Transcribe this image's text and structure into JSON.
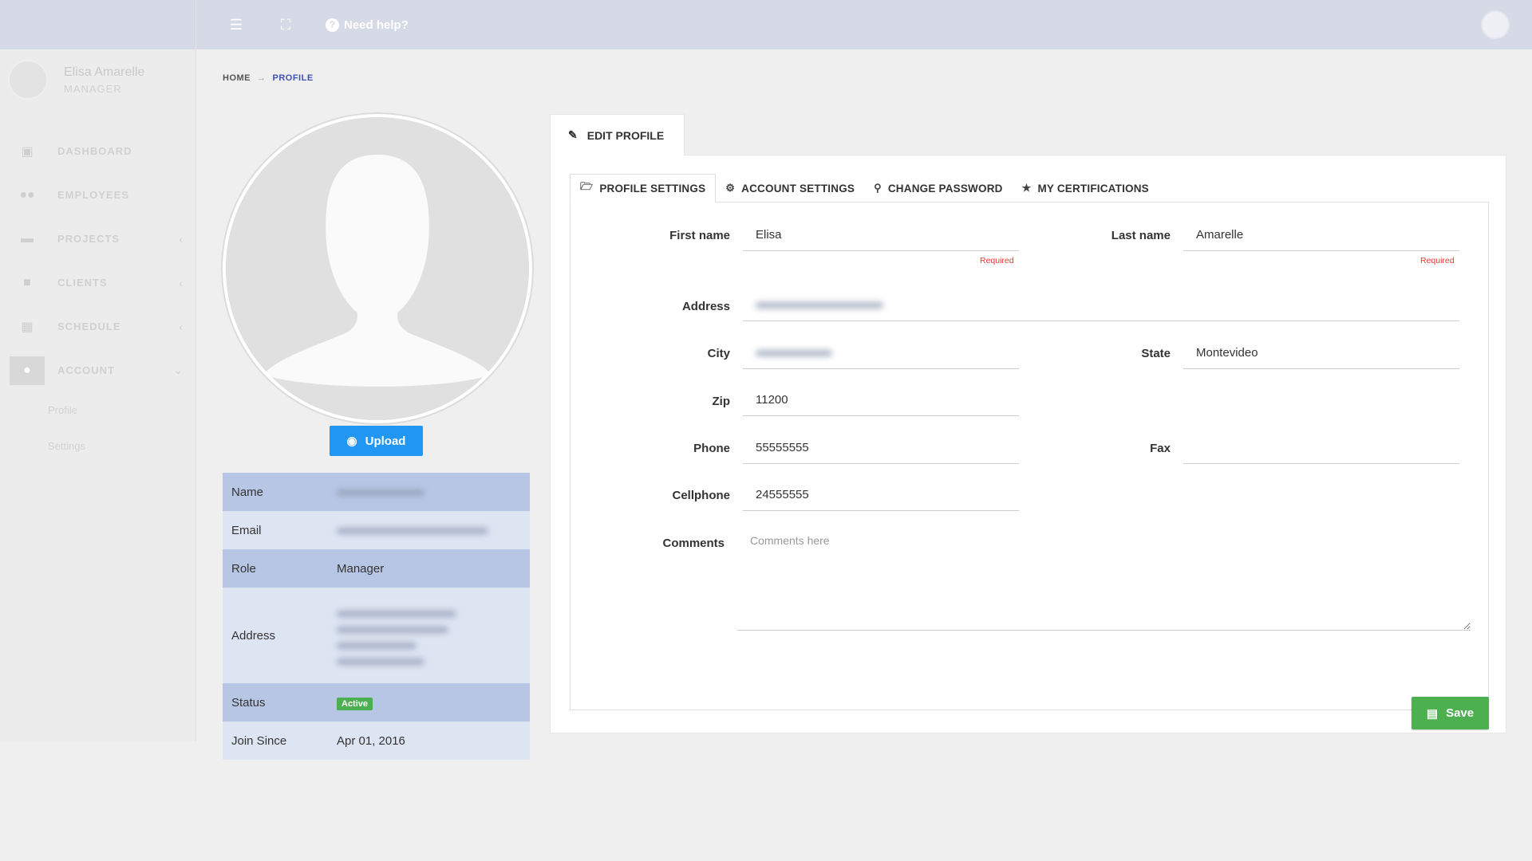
{
  "sidebar": {
    "user": {
      "name": "Elisa Amarelle",
      "role": "MANAGER"
    },
    "items": [
      {
        "label": "DASHBOARD",
        "icon": "monitor-icon"
      },
      {
        "label": "EMPLOYEES",
        "icon": "users-icon"
      },
      {
        "label": "PROJECTS",
        "icon": "folder-icon"
      },
      {
        "label": "CLIENTS",
        "icon": "briefcase-icon"
      },
      {
        "label": "SCHEDULE",
        "icon": "calendar-icon"
      },
      {
        "label": "ACCOUNT",
        "icon": "user-icon"
      }
    ],
    "subitems": [
      {
        "label": "Profile"
      },
      {
        "label": "Settings"
      }
    ]
  },
  "topbar": {
    "help_label": "Need help?"
  },
  "breadcrumb": {
    "home": "HOME",
    "sep": "→",
    "current": "PROFILE"
  },
  "profile": {
    "upload_label": "Upload",
    "rows": {
      "name_key": "Name",
      "email_key": "Email",
      "role_key": "Role",
      "role_value": "Manager",
      "address_key": "Address",
      "status_key": "Status",
      "status_value": "Active",
      "join_key": "Join Since",
      "join_value": "Apr 01, 2016"
    }
  },
  "edit": {
    "tab_label": "EDIT PROFILE",
    "subtabs": [
      {
        "label": "PROFILE SETTINGS",
        "icon": "folder-open-icon"
      },
      {
        "label": "ACCOUNT SETTINGS",
        "icon": "cogs-icon"
      },
      {
        "label": "CHANGE PASSWORD",
        "icon": "key-icon"
      },
      {
        "label": "MY CERTIFICATIONS",
        "icon": "award-icon"
      }
    ],
    "required_label": "Required",
    "fields": {
      "first_name": {
        "label": "First name",
        "value": "Elisa"
      },
      "last_name": {
        "label": "Last name",
        "value": "Amarelle"
      },
      "address": {
        "label": "Address"
      },
      "city": {
        "label": "City"
      },
      "state": {
        "label": "State",
        "value": "Montevideo"
      },
      "zip": {
        "label": "Zip",
        "value": "11200"
      },
      "phone": {
        "label": "Phone",
        "value": "55555555"
      },
      "fax": {
        "label": "Fax",
        "value": ""
      },
      "cellphone": {
        "label": "Cellphone",
        "value": "24555555"
      },
      "comments": {
        "label": "Comments",
        "placeholder": "Comments here"
      }
    },
    "save_label": "Save"
  },
  "colors": {
    "accent": "#3f51b5",
    "upload": "#2196f3",
    "save": "#4caf50",
    "required": "#e53935"
  }
}
